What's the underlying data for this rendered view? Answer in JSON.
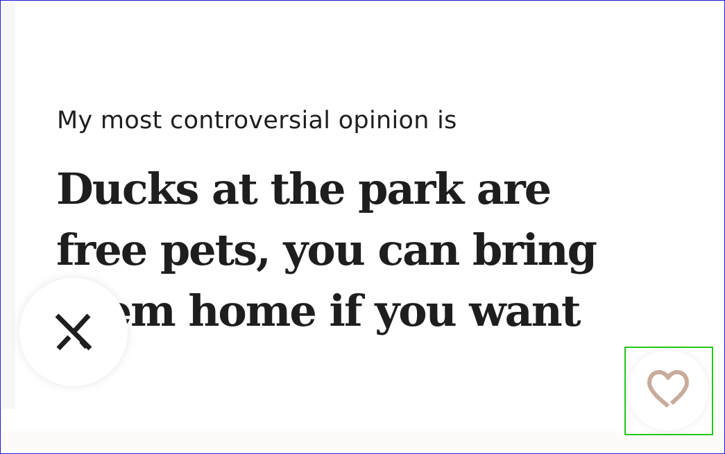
{
  "prompt_card": {
    "prompt": "My most controversial opinion is",
    "answer": "Ducks at the park are free pets, you can bring them home if you want"
  },
  "actions": {
    "skip_icon": "close-x-icon",
    "like_icon": "heart-outline-icon"
  },
  "colors": {
    "text": "#1e1e1e",
    "heart": "#c9ab9b",
    "frame_border": "#1a1ad6",
    "highlight": "#22c81a"
  }
}
